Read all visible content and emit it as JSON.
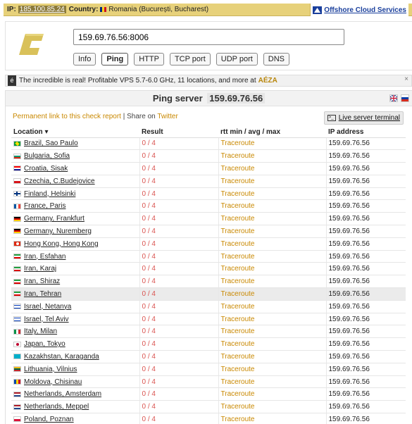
{
  "topbar": {
    "ip_label": "IP:",
    "ip_value": "185.100.85.24",
    "country_label": "Country:",
    "country_value": "Romania (București, Bucharest)",
    "ad_link": "Offshore Cloud Services"
  },
  "header": {
    "host_input": "159.69.76.56:8006",
    "modes": [
      "Info",
      "Ping",
      "HTTP",
      "TCP port",
      "UDP port",
      "DNS"
    ],
    "active_mode": "Ping"
  },
  "adbar": {
    "icon_letter": "é",
    "text": "The incredible is real! Profitable VPS 5.7-6.0 GHz, 11 locations, and more at",
    "brand": "AÉZA",
    "close": "×"
  },
  "main": {
    "title_prefix": "Ping server",
    "title_host": "159.69.76.56",
    "permalink": "Permanent link to this check report",
    "separator": "|",
    "share_text": "Share on",
    "share_link": "Twitter",
    "live_terminal": "Live server terminal",
    "columns": [
      "Location ▾",
      "Result",
      "rtt min / avg / max",
      "IP address"
    ],
    "rows": [
      {
        "location": "Brazil, Sao Paulo",
        "flag": "br",
        "result": "0 / 4",
        "rtt": "Traceroute",
        "ip": "159.69.76.56"
      },
      {
        "location": "Bulgaria, Sofia",
        "flag": "bg",
        "result": "0 / 4",
        "rtt": "Traceroute",
        "ip": "159.69.76.56"
      },
      {
        "location": "Croatia, Sisak",
        "flag": "hr",
        "result": "0 / 4",
        "rtt": "Traceroute",
        "ip": "159.69.76.56"
      },
      {
        "location": "Czechia, C.Budejovice",
        "flag": "cz",
        "result": "0 / 4",
        "rtt": "Traceroute",
        "ip": "159.69.76.56"
      },
      {
        "location": "Finland, Helsinki",
        "flag": "fi",
        "result": "0 / 4",
        "rtt": "Traceroute",
        "ip": "159.69.76.56"
      },
      {
        "location": "France, Paris",
        "flag": "fr",
        "result": "0 / 4",
        "rtt": "Traceroute",
        "ip": "159.69.76.56"
      },
      {
        "location": "Germany, Frankfurt",
        "flag": "de",
        "result": "0 / 4",
        "rtt": "Traceroute",
        "ip": "159.69.76.56"
      },
      {
        "location": "Germany, Nuremberg",
        "flag": "de",
        "result": "0 / 4",
        "rtt": "Traceroute",
        "ip": "159.69.76.56"
      },
      {
        "location": "Hong Kong, Hong Kong",
        "flag": "hk",
        "result": "0 / 4",
        "rtt": "Traceroute",
        "ip": "159.69.76.56"
      },
      {
        "location": "Iran, Esfahan",
        "flag": "ir",
        "result": "0 / 4",
        "rtt": "Traceroute",
        "ip": "159.69.76.56"
      },
      {
        "location": "Iran, Karaj",
        "flag": "ir",
        "result": "0 / 4",
        "rtt": "Traceroute",
        "ip": "159.69.76.56"
      },
      {
        "location": "Iran, Shiraz",
        "flag": "ir",
        "result": "0 / 4",
        "rtt": "Traceroute",
        "ip": "159.69.76.56"
      },
      {
        "location": "Iran, Tehran",
        "flag": "ir",
        "result": "0 / 4",
        "rtt": "Traceroute",
        "ip": "159.69.76.56",
        "highlight": true
      },
      {
        "location": "Israel, Netanya",
        "flag": "il",
        "result": "0 / 4",
        "rtt": "Traceroute",
        "ip": "159.69.76.56"
      },
      {
        "location": "Israel, Tel Aviv",
        "flag": "il",
        "result": "0 / 4",
        "rtt": "Traceroute",
        "ip": "159.69.76.56"
      },
      {
        "location": "Italy, Milan",
        "flag": "it",
        "result": "0 / 4",
        "rtt": "Traceroute",
        "ip": "159.69.76.56"
      },
      {
        "location": "Japan, Tokyo",
        "flag": "jp",
        "result": "0 / 4",
        "rtt": "Traceroute",
        "ip": "159.69.76.56"
      },
      {
        "location": "Kazakhstan, Karaganda",
        "flag": "kz",
        "result": "0 / 4",
        "rtt": "Traceroute",
        "ip": "159.69.76.56"
      },
      {
        "location": "Lithuania, Vilnius",
        "flag": "lt",
        "result": "0 / 4",
        "rtt": "Traceroute",
        "ip": "159.69.76.56"
      },
      {
        "location": "Moldova, Chisinau",
        "flag": "md",
        "result": "0 / 4",
        "rtt": "Traceroute",
        "ip": "159.69.76.56"
      },
      {
        "location": "Netherlands, Amsterdam",
        "flag": "nl",
        "result": "0 / 4",
        "rtt": "Traceroute",
        "ip": "159.69.76.56"
      },
      {
        "location": "Netherlands, Meppel",
        "flag": "nl",
        "result": "0 / 4",
        "rtt": "Traceroute",
        "ip": "159.69.76.56"
      },
      {
        "location": "Poland, Poznan",
        "flag": "pl",
        "result": "0 / 4",
        "rtt": "Traceroute",
        "ip": "159.69.76.56"
      }
    ]
  },
  "colors": {
    "topbar_bg": "#e7d17a",
    "link_orange": "#c98800",
    "result_red": "#d9534f",
    "ad_blue": "#1a3f9c",
    "logo_gold": "#d9c15a"
  }
}
